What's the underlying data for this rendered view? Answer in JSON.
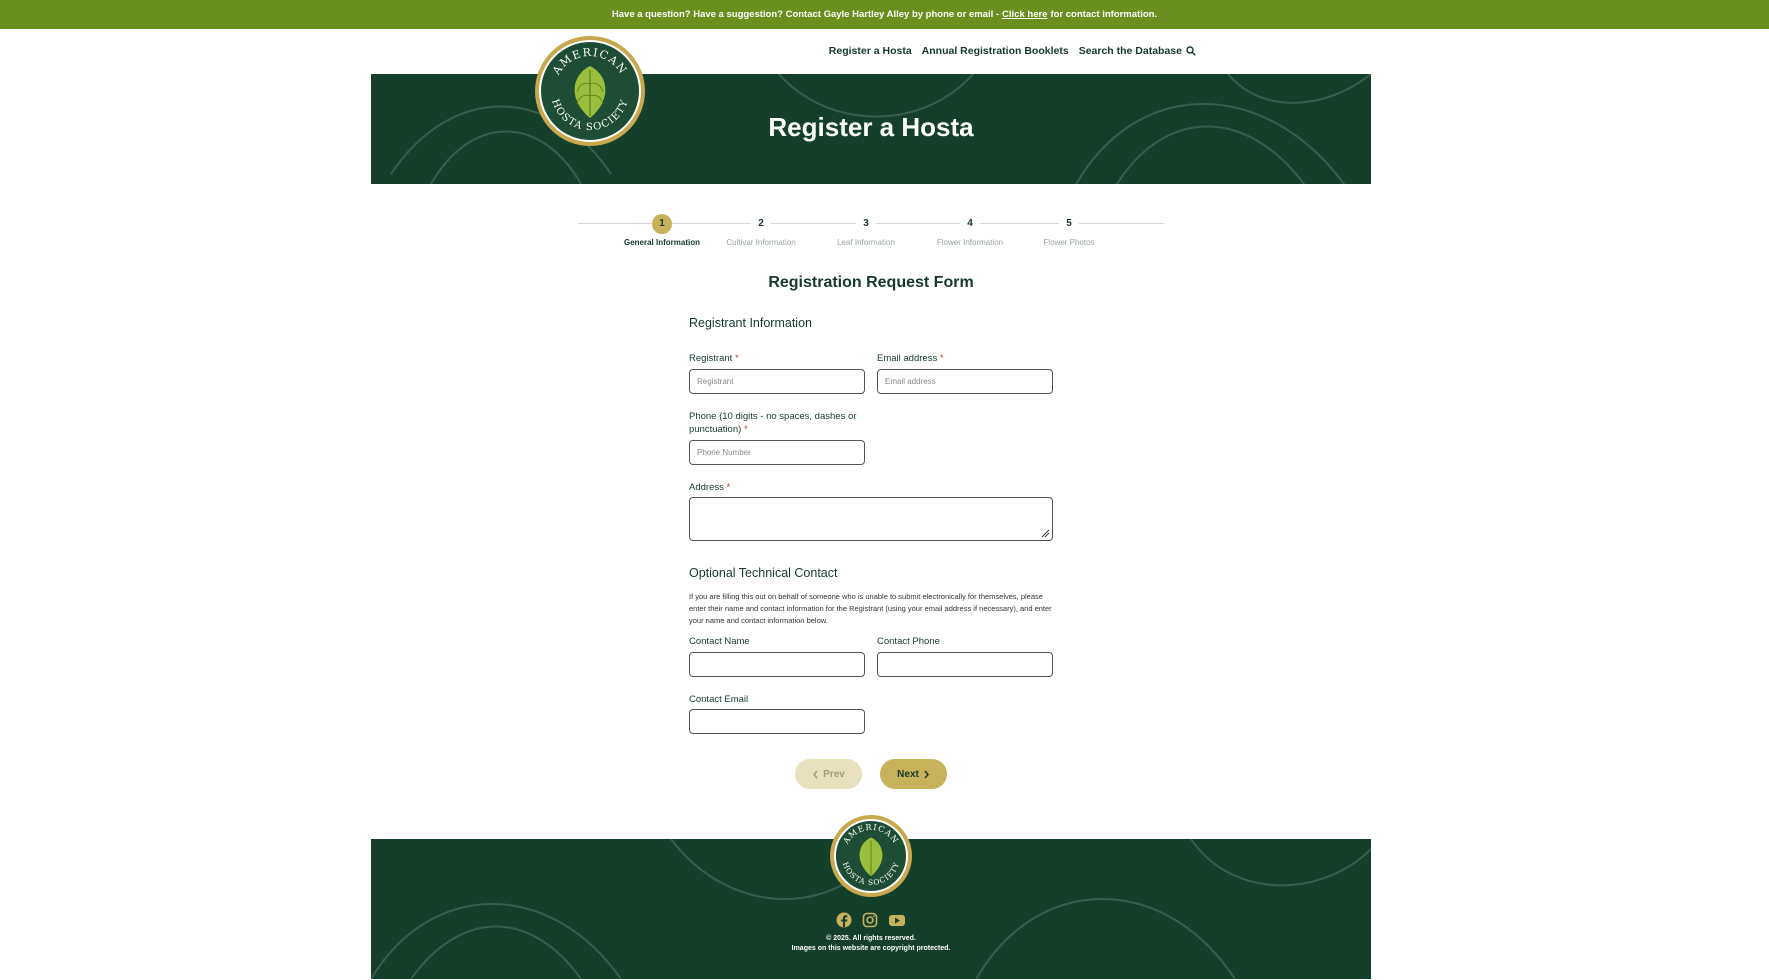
{
  "topbar": {
    "text_before": "Have a question? Have a suggestion? Contact Gayle Hartley Alley by phone or email -",
    "link": "Click here",
    "text_after": "for contact information."
  },
  "nav": {
    "items": [
      "Register a Hosta",
      "Annual Registration Booklets",
      "Search the Database"
    ]
  },
  "logo": {
    "ring_text_top": "AMERICAN",
    "ring_text_bottom": "HOSTA SOCIETY"
  },
  "hero": {
    "title": "Register a Hosta"
  },
  "steps": [
    {
      "num": "1",
      "label": "General Information"
    },
    {
      "num": "2",
      "label": "Cultivar Information"
    },
    {
      "num": "3",
      "label": "Leaf Information"
    },
    {
      "num": "4",
      "label": "Flower Information"
    },
    {
      "num": "5",
      "label": "Flower Photos"
    }
  ],
  "form": {
    "title": "Registration Request Form",
    "registrant_section": "Registrant Information",
    "registrant_label": "Registrant",
    "registrant_placeholder": "Registrant",
    "email_label": "Email address",
    "email_placeholder": "Email address",
    "phone_label": "Phone (10 digits - no spaces, dashes or punctuation)",
    "phone_placeholder": "Phone Number",
    "address_label": "Address",
    "required_mark": "*",
    "tech_section": "Optional Technical Contact",
    "tech_note": "If you are filling this out on behalf of someone who is unable to submit electronically for themselves, please enter their name and contact information for the Registrant (using your email address if necessary), and enter your name and contact information below.",
    "contact_name_label": "Contact Name",
    "contact_phone_label": "Contact Phone",
    "contact_email_label": "Contact Email",
    "prev": "Prev",
    "next": "Next"
  },
  "footer": {
    "copyright": "© 2025. All rights reserved.",
    "images_note": "Images on this website are copyright protected."
  },
  "colors": {
    "topbar": "#6b8f1e",
    "dark_green": "#133f2b",
    "gold": "#c7b15a"
  }
}
